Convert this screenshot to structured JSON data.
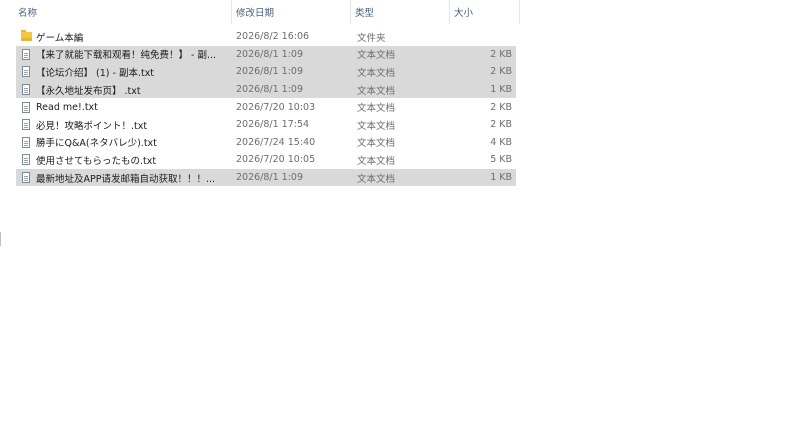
{
  "header": {
    "name": "名称",
    "date": "修改日期",
    "type": "类型",
    "size": "大小",
    "sort_indicator": "^"
  },
  "files": [
    {
      "icon": "folder-icon",
      "name": "ゲーム本編",
      "date": "2026/8/2 16:06",
      "type": "文件夹",
      "size": "",
      "selected": false
    },
    {
      "icon": "text-file-icon",
      "name": "【来了就能下载和观看！纯免费！】 - 副...",
      "date": "2026/8/1 1:09",
      "type": "文本文档",
      "size": "2 KB",
      "selected": true
    },
    {
      "icon": "text-file-icon",
      "name": "【论坛介绍】 (1) - 副本.txt",
      "date": "2026/8/1 1:09",
      "type": "文本文档",
      "size": "2 KB",
      "selected": true
    },
    {
      "icon": "text-file-icon",
      "name": "【永久地址发布页】 .txt",
      "date": "2026/8/1 1:09",
      "type": "文本文档",
      "size": "1 KB",
      "selected": true
    },
    {
      "icon": "text-file-icon",
      "name": "Read me!.txt",
      "date": "2026/7/20 10:03",
      "type": "文本文档",
      "size": "2 KB",
      "selected": false
    },
    {
      "icon": "text-file-icon",
      "name": "必見！攻略ポイント！.txt",
      "date": "2026/8/1 17:54",
      "type": "文本文档",
      "size": "2 KB",
      "selected": false
    },
    {
      "icon": "text-file-icon",
      "name": "勝手にQ&A(ネタバレ少).txt",
      "date": "2026/7/24 15:40",
      "type": "文本文档",
      "size": "4 KB",
      "selected": false
    },
    {
      "icon": "text-file-icon",
      "name": "使用させてもらったもの.txt",
      "date": "2026/7/20 10:05",
      "type": "文本文档",
      "size": "5 KB",
      "selected": false
    },
    {
      "icon": "text-file-icon",
      "name": "最新地址及APP请发邮箱自动获取！！！...",
      "date": "2026/8/1 1:09",
      "type": "文本文档",
      "size": "1 KB",
      "selected": true
    }
  ]
}
